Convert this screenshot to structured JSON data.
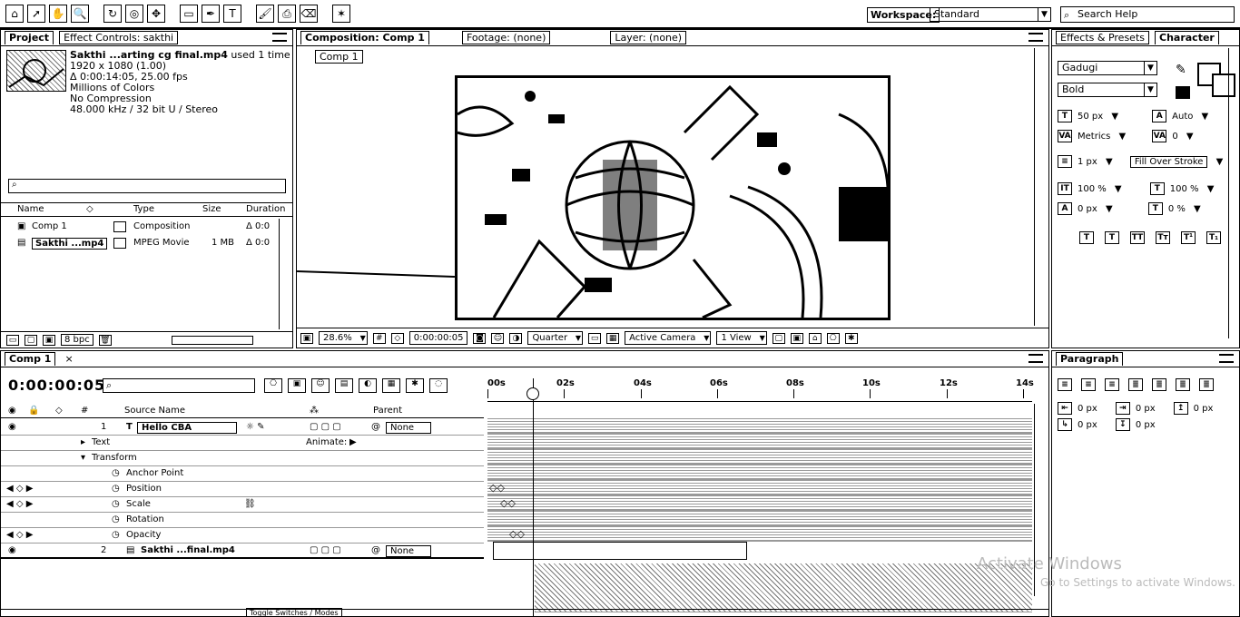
{
  "toolbar": {
    "workspace_label": "Workspace:",
    "workspace_value": "Standard",
    "search_help_placeholder": "Search Help"
  },
  "project": {
    "tabs": [
      "Project",
      "Effect Controls: sakthi"
    ],
    "clip_name": "Sakthi ...arting cg final.mp4",
    "clip_used": "used 1 time",
    "info_lines": [
      "1920 x 1080 (1.00)",
      "Δ 0:00:14:05, 25.00 fps",
      "Millions of Colors",
      "No Compression",
      "48.000 kHz / 32 bit U / Stereo"
    ],
    "columns": [
      "Name",
      "Type",
      "Size",
      "Duration"
    ],
    "rows": [
      {
        "name": "Comp 1",
        "type": "Composition",
        "size": "",
        "duration": "Δ 0:0"
      },
      {
        "name": "Sakthi ...mp4",
        "type": "MPEG Movie",
        "size": "1 MB",
        "duration": "Δ 0:0"
      }
    ],
    "bpc": "8 bpc"
  },
  "viewer": {
    "tabs": [
      "Composition: Comp 1",
      "Footage: (none)",
      "Layer: (none)"
    ],
    "chip": "Comp 1",
    "zoom": "28.6%",
    "timecode": "0:00:00:05",
    "resolution": "Quarter",
    "camera": "Active Camera",
    "view": "1 View"
  },
  "effects": {
    "tabs": [
      "Effects & Presets",
      "Character"
    ],
    "font_family": "Gadugi",
    "font_style": "Bold",
    "size": "50 px",
    "leading": "Auto",
    "kerning": "Metrics",
    "tracking": "0",
    "stroke_width": "1 px",
    "stroke_mode": "Fill Over Stroke",
    "vscale": "100 %",
    "hscale": "100 %",
    "baseline": "0 px",
    "tsume": "0 %"
  },
  "timeline": {
    "tab": "Comp 1",
    "time": "0:00:00:05",
    "columns": [
      "Source Name",
      "Parent"
    ],
    "layers": [
      {
        "name": "Hello CBA",
        "parent": "None",
        "kind": "T"
      },
      {
        "name": "Text",
        "animate": "Animate:"
      },
      {
        "name": "Transform"
      },
      {
        "name": "Anchor Point"
      },
      {
        "name": "Position"
      },
      {
        "name": "Scale"
      },
      {
        "name": "Rotation"
      },
      {
        "name": "Opacity"
      },
      {
        "name": "Sakthi ...final.mp4",
        "parent": "None"
      }
    ],
    "ruler": [
      "00s",
      "02s",
      "04s",
      "06s",
      "08s",
      "10s",
      "12s",
      "14s"
    ],
    "bottom_label": "Toggle Switches / Modes"
  },
  "paragraph": {
    "tab": "Paragraph",
    "indent_values": [
      "0 px",
      "0 px",
      "0 px",
      "0 px",
      "0 px"
    ]
  },
  "watermark": {
    "title": "Activate Windows",
    "subtitle": "Go to Settings to activate Windows."
  }
}
